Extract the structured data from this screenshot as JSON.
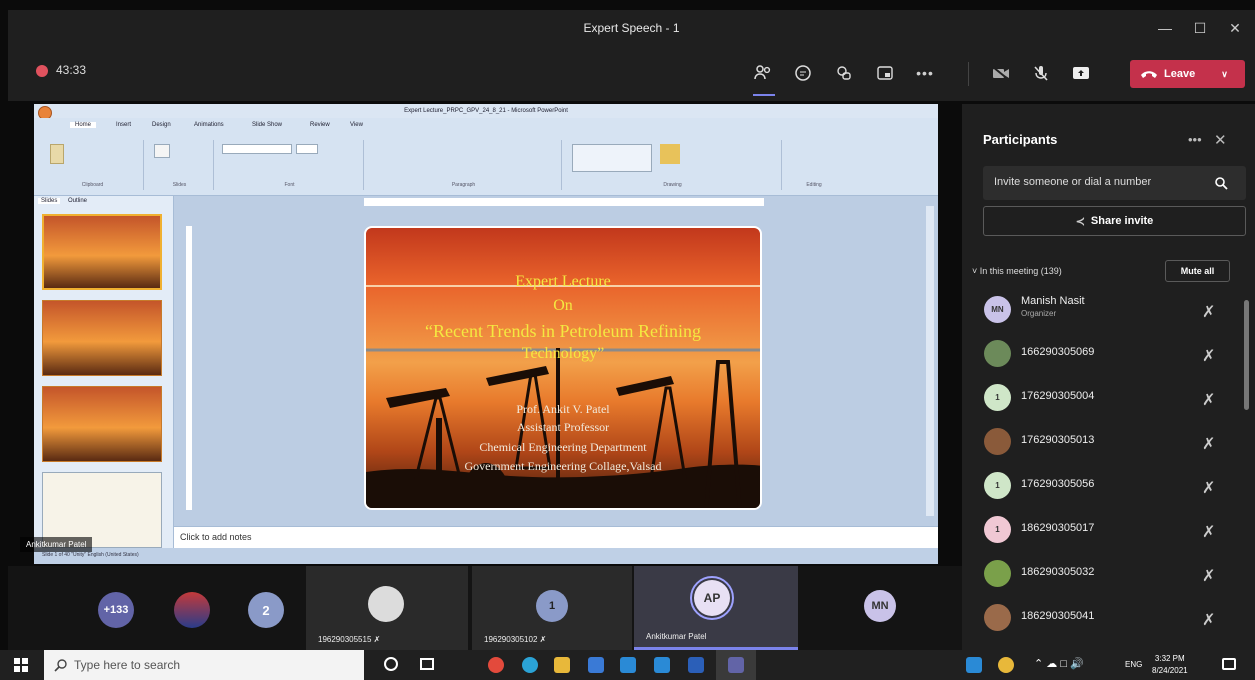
{
  "window": {
    "title": "Expert Speech - 1"
  },
  "meeting": {
    "timer": "43:33",
    "leave_label": "Leave"
  },
  "ppt": {
    "window_title": "Expert Lecture_PRPC_GPV_24_8_21 - Microsoft PowerPoint",
    "tabs": [
      "Home",
      "Insert",
      "Design",
      "Animations",
      "Slide Show",
      "Review",
      "View"
    ],
    "groups": [
      "Clipboard",
      "Slides",
      "Font",
      "Paragraph",
      "Drawing",
      "Editing"
    ],
    "left_tabs": [
      "Slides",
      "Outline"
    ],
    "notes_placeholder": "Click to add notes",
    "status": "Slide 1 of 40     \"Unity\"     English (United States)"
  },
  "slide": {
    "title1": "Expert Lecture",
    "title2": "On",
    "title3": "“Recent Trends in Petroleum Refining",
    "title4": "Technology”",
    "line1": "Prof. Ankit V. Patel",
    "line2": "Assistant Professor",
    "line3": "Chemical Engineering Department",
    "line4": "Government Engineering Collage,Valsad"
  },
  "presenter_tag": "Ankitkumar Patel",
  "participants": {
    "title": "Participants",
    "invite_placeholder": "Invite someone or dial a number",
    "share_label": "Share invite",
    "in_meeting": "In this meeting (139)",
    "mute_all": "Mute all",
    "list": [
      {
        "initials": "MN",
        "name": "Manish Nasit",
        "sub": "Organizer",
        "color": "#c9c2e8"
      },
      {
        "initials": "",
        "name": "166290305069",
        "sub": "",
        "color": "#6c8a5a"
      },
      {
        "initials": "1",
        "name": "176290305004",
        "sub": "",
        "color": "#cfe6c8"
      },
      {
        "initials": "",
        "name": "176290305013",
        "sub": "",
        "color": "#8a5a3a"
      },
      {
        "initials": "1",
        "name": "176290305056",
        "sub": "",
        "color": "#cfe6c8"
      },
      {
        "initials": "1",
        "name": "186290305017",
        "sub": "",
        "color": "#f0c8d4"
      },
      {
        "initials": "",
        "name": "186290305032",
        "sub": "",
        "color": "#7aa04a"
      },
      {
        "initials": "",
        "name": "186290305041",
        "sub": "",
        "color": "#9a6a4a"
      }
    ]
  },
  "tiles": {
    "overflow": "+133",
    "count2": "2",
    "t1_name": "196290305515",
    "t2_initial": "1",
    "t2_name": "196290305102",
    "ap_initials": "AP",
    "ap_name": "Ankitkumar Patel",
    "mn_initials": "MN"
  },
  "taskbar": {
    "search_placeholder": "Type here to search",
    "lang": "ENG",
    "time": "3:32 PM",
    "date": "8/24/2021"
  },
  "colors": {
    "leave": "#c4314b",
    "accent": "#6264a7",
    "panel": "#1f1f1f"
  }
}
